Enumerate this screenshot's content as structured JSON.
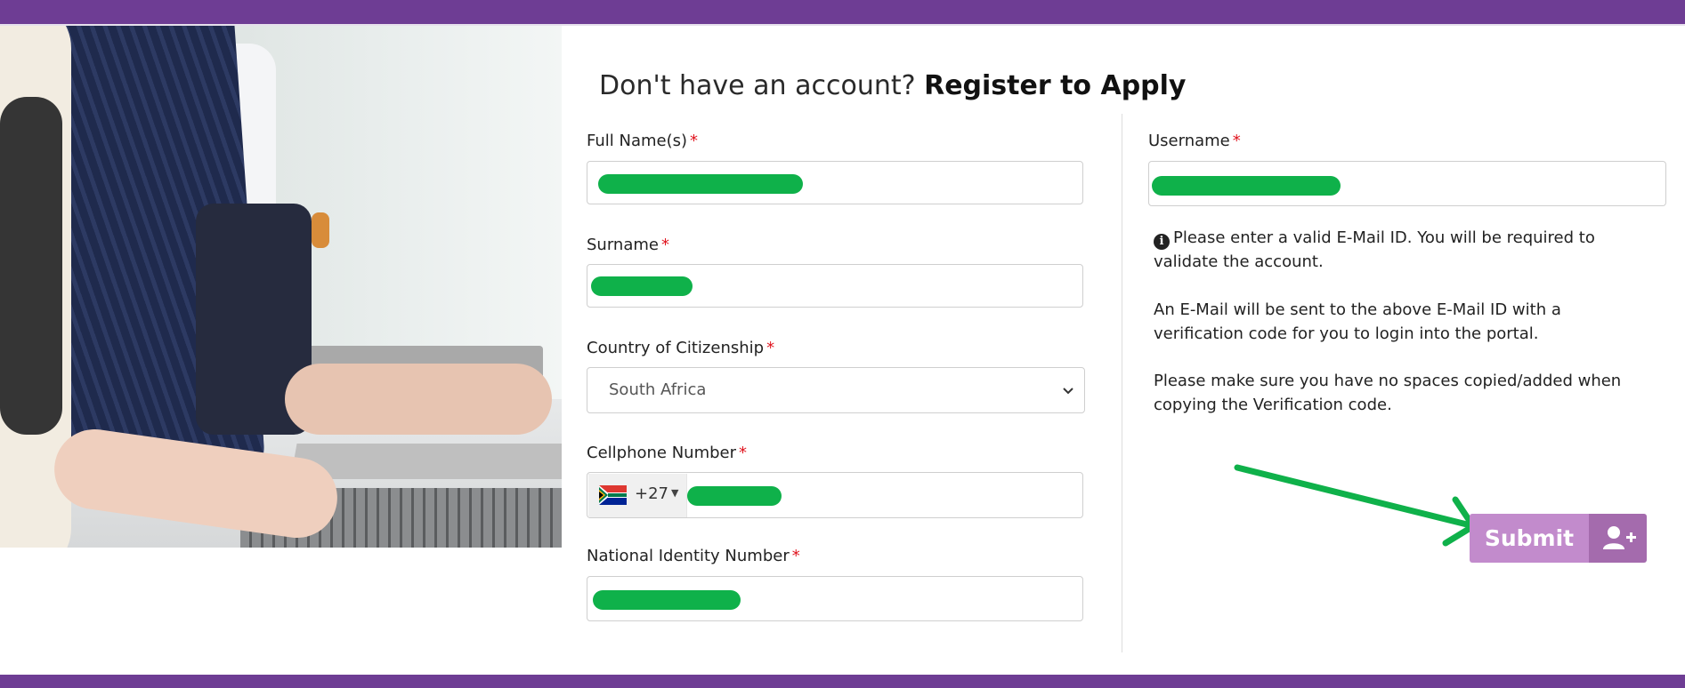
{
  "colors": {
    "brand": "#6e3d94",
    "submit": "#c28bcc",
    "submit_icon_bg": "#a46bad",
    "required": "#e0141e",
    "annotation_green": "#0fb14a"
  },
  "heading": {
    "prefix": "Don't have an account?",
    "emphasis": "Register to Apply"
  },
  "required_marker": "*",
  "form": {
    "full_name": {
      "label": "Full Name(s)",
      "value": ""
    },
    "surname": {
      "label": "Surname",
      "value": ""
    },
    "country": {
      "label": "Country of Citizenship",
      "selected": "South Africa"
    },
    "cellphone": {
      "label": "Cellphone Number",
      "country_code": "+27",
      "flag_icon": "south-africa-flag-icon",
      "value": ""
    },
    "national_id": {
      "label": "National Identity Number",
      "value": ""
    },
    "username": {
      "label": "Username",
      "value": ""
    }
  },
  "info": {
    "icon": "info-circle-icon",
    "line1": "Please enter a valid E-Mail ID. You will be required to validate the account.",
    "line2": "An E-Mail will be sent to the above E-Mail ID with a verification code for you to login into the portal.",
    "line3": "Please make sure you have no spaces copied/added when copying the Verification code."
  },
  "submit": {
    "label": "Submit",
    "icon": "user-plus-icon"
  }
}
